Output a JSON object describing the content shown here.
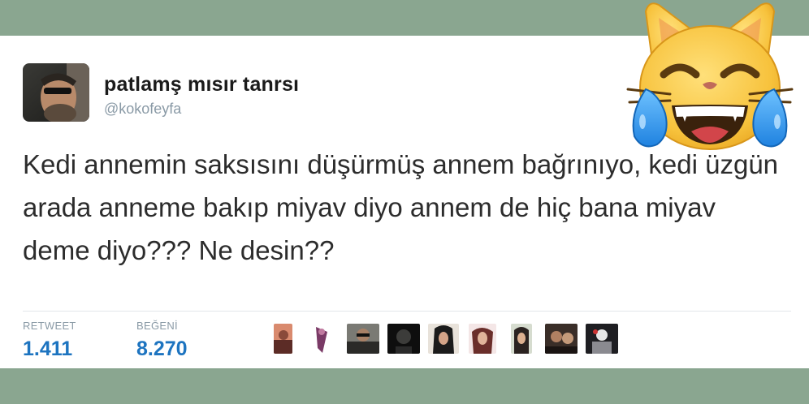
{
  "tweet": {
    "display_name": "patlamş mısır tanrsı",
    "handle": "@kokofeyfa",
    "text": "Kedi annemin saksısını düşürmüş annem bağrınıyo, kedi üzgün arada anneme bakıp miyav diyo annem de hiç bana miyav deme diyo??? Ne desin??"
  },
  "stats": {
    "retweet_label": "RETWEET",
    "retweet_count": "1.411",
    "like_label": "BEĞENİ",
    "like_count": "8.270"
  },
  "colors": {
    "background": "#8aa690",
    "card": "#ffffff",
    "stat_value": "#1d74c0",
    "muted": "#8a9aa6"
  },
  "icons": {
    "emoji": "cat-face-with-tears-of-joy-icon"
  }
}
